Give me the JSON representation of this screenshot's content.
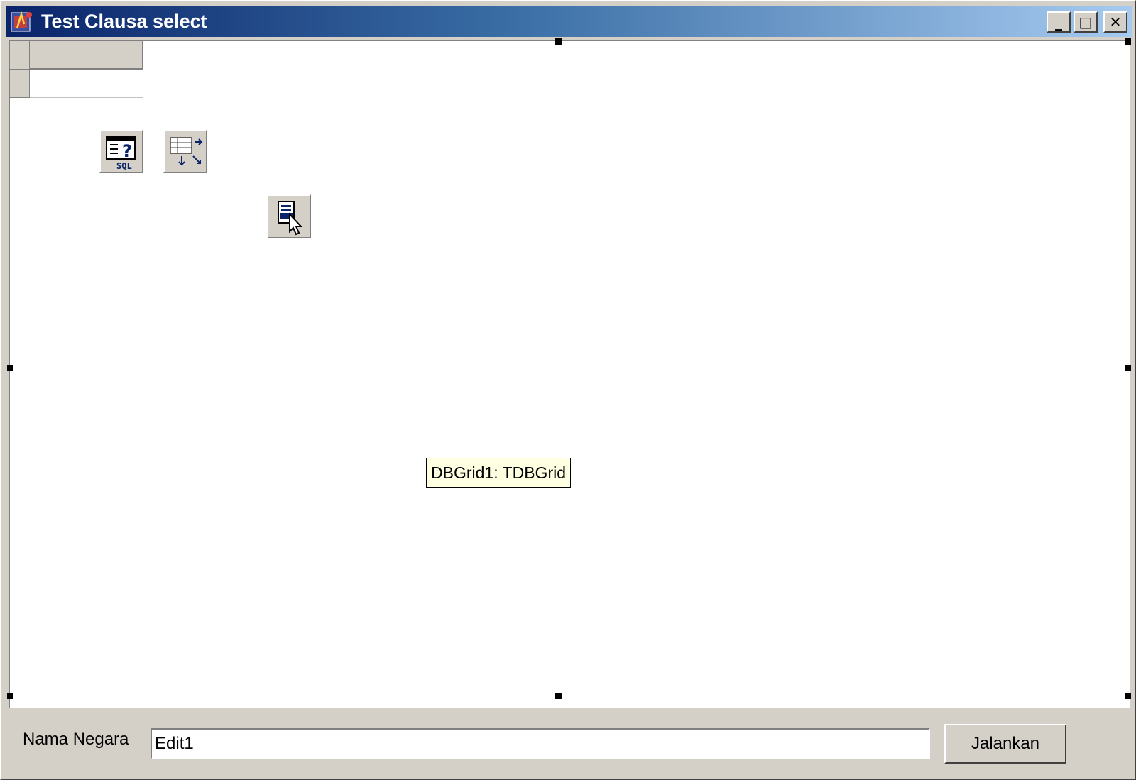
{
  "window": {
    "title": "Test Clausa select",
    "buttons": {
      "minimize": "_",
      "maximize": "□",
      "close": "✕"
    }
  },
  "designer": {
    "components": [
      {
        "icon": "sql-query-icon"
      },
      {
        "icon": "table-icon"
      },
      {
        "icon": "datasource-icon"
      }
    ],
    "tooltip": "DBGrid1: TDBGrid"
  },
  "form": {
    "label": "Nama Negara",
    "edit_value": "Edit1",
    "run_button": "Jalankan"
  },
  "colors": {
    "titlebar_start": "#0a246a",
    "titlebar_end": "#a6caf0",
    "face": "#d4d0c8",
    "tooltip_bg": "#ffffe1"
  }
}
